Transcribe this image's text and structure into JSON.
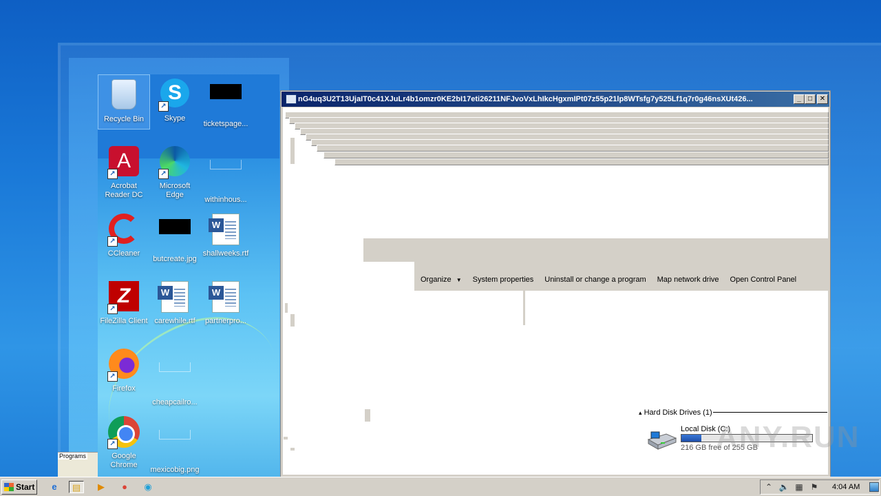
{
  "desktop": {
    "icons": [
      {
        "label": "Recycle Bin"
      },
      {
        "label": "Skype"
      },
      {
        "label": "ticketspage..."
      },
      {
        "label": "Acrobat Reader DC"
      },
      {
        "label": "Microsoft Edge"
      },
      {
        "label": "withinhous..."
      },
      {
        "label": "CCleaner"
      },
      {
        "label": "butcreate.jpg"
      },
      {
        "label": "shallweeks.rtf"
      },
      {
        "label": "FileZilla Client"
      },
      {
        "label": "carewhile.rtf"
      },
      {
        "label": "partnerpro..."
      },
      {
        "label": "Firefox"
      },
      {
        "label": "cheapcailro..."
      },
      {
        "label": "Google Chrome"
      },
      {
        "label": "mexicobig.png"
      }
    ],
    "programs_fragment": "Programs"
  },
  "window": {
    "title": "nG4uq3U2T13UjaIT0c41XJuLr4b1omzr0KE2bI17eti26211NFJvoVxLhIkcHgxmIPt07z55p21lp8WTsfg7y525Lf1q7r0g46nsXUt426...",
    "buttons": {
      "minimize": "_",
      "maximize": "□",
      "close": "✕"
    },
    "toolbar": {
      "organize": "Organize",
      "organize_arrow": "▼",
      "system_properties": "System properties",
      "uninstall": "Uninstall or change a program",
      "map_drive": "Map network drive",
      "control_panel": "Open Control Panel"
    },
    "group": {
      "arrow": "▴",
      "header": "Hard Disk Drives (1)"
    },
    "drive": {
      "name": "Local Disk (C:)",
      "free_text": "216 GB free of 255 GB",
      "used_fraction": 0.153
    },
    "watermark": "ANY.RUN"
  },
  "taskbar": {
    "start_label": "Start",
    "apps": [
      {
        "icon": "internet-explorer-icon",
        "glyph": "e"
      },
      {
        "icon": "file-explorer-icon",
        "glyph": "▤"
      },
      {
        "icon": "media-player-icon",
        "glyph": "▶"
      },
      {
        "icon": "chrome-icon",
        "glyph": "●"
      },
      {
        "icon": "edge-icon",
        "glyph": "◉"
      }
    ],
    "tray": {
      "expand": "⌃",
      "volume": "🔈",
      "network": "▦",
      "flag": "⚑",
      "clock": "4:04 AM"
    }
  },
  "colors": {
    "title_bar_start": "#0a246a",
    "title_bar_end": "#3a6ea5",
    "drive_fill": "#1f4fa8",
    "classic_gray": "#d4d0c8"
  }
}
